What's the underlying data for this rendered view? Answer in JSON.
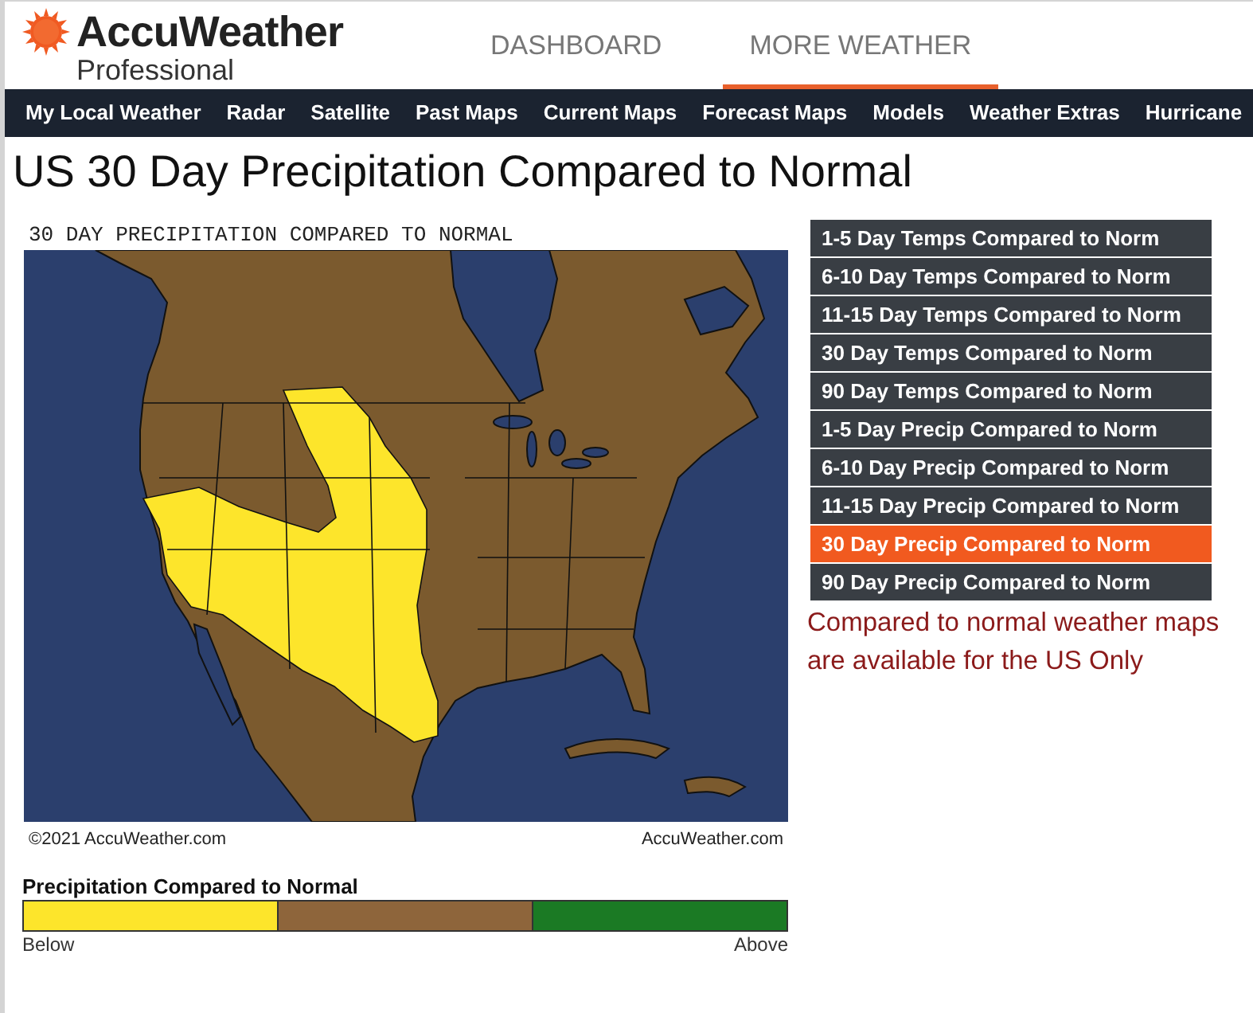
{
  "header": {
    "logo": {
      "brand": "AccuWeather",
      "subtitle": "Professional"
    },
    "tabs": [
      {
        "label": "DASHBOARD",
        "selected": false
      },
      {
        "label": "MORE WEATHER",
        "selected": true
      }
    ]
  },
  "nav": {
    "items": [
      "My Local Weather",
      "Radar",
      "Satellite",
      "Past Maps",
      "Current Maps",
      "Forecast Maps",
      "Models",
      "Weather Extras",
      "Hurricane"
    ]
  },
  "page_title": "US 30 Day Precipitation Compared to Normal",
  "map": {
    "title": "30 DAY PRECIPITATION COMPARED TO NORMAL",
    "copyright": "©2021 AccuWeather.com",
    "credit": "AccuWeather.com",
    "legend": {
      "title": "Precipitation Compared to Normal",
      "segments": [
        {
          "color": "#fde52b"
        },
        {
          "color": "#8e653b"
        },
        {
          "color": "#1b7a24"
        }
      ],
      "low_label": "Below",
      "high_label": "Above"
    }
  },
  "sidebar": {
    "links": [
      {
        "label": "1-5 Day Temps Compared to Norm",
        "selected": false
      },
      {
        "label": "6-10 Day Temps Compared to Norm",
        "selected": false
      },
      {
        "label": "11-15 Day Temps Compared to Norm",
        "selected": false
      },
      {
        "label": "30 Day Temps Compared to Norm",
        "selected": false
      },
      {
        "label": "90 Day Temps Compared to Norm",
        "selected": false
      },
      {
        "label": "1-5 Day Precip Compared to Norm",
        "selected": false
      },
      {
        "label": "6-10 Day Precip Compared to Norm",
        "selected": false
      },
      {
        "label": "11-15 Day Precip Compared to Norm",
        "selected": false
      },
      {
        "label": "30 Day Precip Compared to Norm",
        "selected": true
      },
      {
        "label": "90 Day Precip Compared to Norm",
        "selected": false
      }
    ],
    "note": "Compared to normal weather maps are available for the US Only"
  }
}
